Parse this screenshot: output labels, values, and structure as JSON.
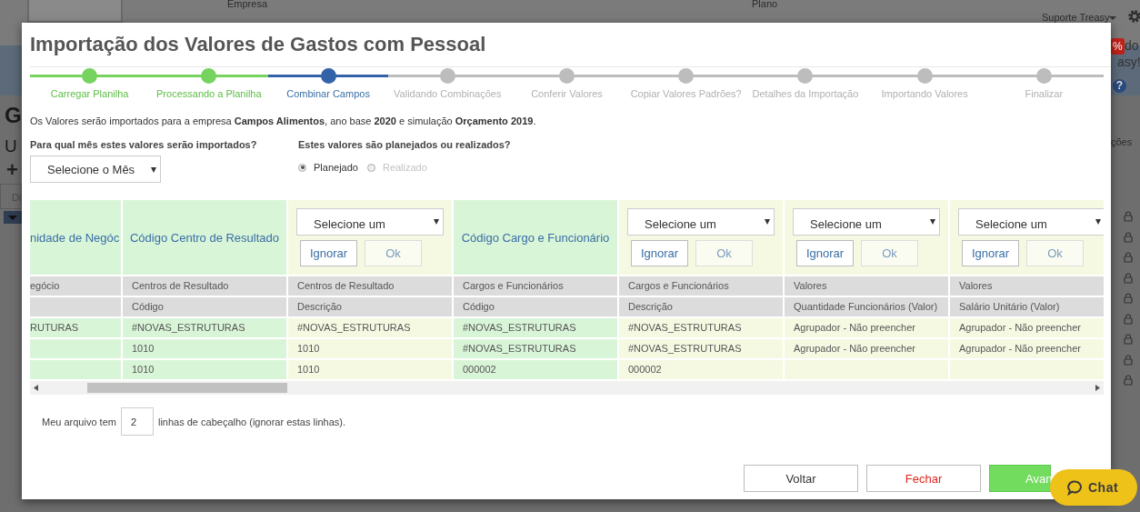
{
  "background": {
    "company_label": "Empresa",
    "plan_label": "Plano",
    "user": "Suporte Treasy",
    "page_title": "G",
    "page_subtitle": "U",
    "add": "+",
    "field": "Di",
    "badge": "%",
    "notice_1": "do",
    "notice_2": "asy!",
    "column_text": "ções",
    "help": "?"
  },
  "modal": {
    "title": "Importação dos Valores de Gastos com Pessoal",
    "steps": [
      {
        "label": "Carregar Planilha",
        "completed": true,
        "selected": false
      },
      {
        "label": "Processando a Planilha",
        "completed": true,
        "selected": false
      },
      {
        "label": "Combinar Campos",
        "completed": false,
        "selected": true
      },
      {
        "label": "Validando Combinações",
        "completed": false,
        "selected": false
      },
      {
        "label": "Conferir Valores",
        "completed": false,
        "selected": false
      },
      {
        "label": "Copiar Valores Padrões?",
        "completed": false,
        "selected": false
      },
      {
        "label": "Detalhes da Importação",
        "completed": false,
        "selected": false
      },
      {
        "label": "Importando Valores",
        "completed": false,
        "selected": false
      },
      {
        "label": "Finalizar",
        "completed": false,
        "selected": false
      }
    ],
    "intro": "Os Valores serão importados para a empresa **Campos Alimentos**, ano base **2020** e simulação **Orçamento 2019**.",
    "month_question": "Para qual mês estes valores serão importados?",
    "month_select": "Selecione o Mês",
    "type_question": "Estes valores são planejados ou realizados?",
    "radios": [
      {
        "label": "Planejado",
        "selected": true,
        "disabled": false
      },
      {
        "label": "Realizado",
        "selected": false,
        "disabled": true
      }
    ],
    "columns": [
      {
        "kind": "mapped",
        "title": "nidade de Negóc",
        "group": "egócio",
        "cells": [
          "RUTURAS",
          null,
          null
        ]
      },
      {
        "kind": "mapped",
        "title": "Código Centro de Resultado",
        "group": "Centros de Resultado",
        "field": "Código",
        "cells": [
          "#NOVAS_ESTRUTURAS",
          "1010",
          "1010"
        ]
      },
      {
        "kind": "unmapped",
        "select": "Selecione um",
        "ignore": "Ignorar",
        "ok": "Ok",
        "group": "Centros de Resultado",
        "field": "Descrição",
        "cells": [
          "#NOVAS_ESTRUTURAS",
          "1010",
          "1010"
        ]
      },
      {
        "kind": "mapped",
        "title": "Código Cargo e Funcionário",
        "group": "Cargos e Funcionários",
        "field": "Código",
        "cells": [
          "#NOVAS_ESTRUTURAS",
          "#NOVAS_ESTRUTURAS",
          "000002"
        ]
      },
      {
        "kind": "unmapped",
        "select": "Selecione um",
        "ignore": "Ignorar",
        "ok": "Ok",
        "group": "Cargos e Funcionários",
        "field": "Descrição",
        "cells": [
          "#NOVAS_ESTRUTURAS",
          "#NOVAS_ESTRUTURAS",
          "000002"
        ]
      },
      {
        "kind": "unmapped",
        "select": "Selecione um",
        "ignore": "Ignorar",
        "ok": "Ok",
        "group": "Valores",
        "field": "Quantidade Funcionários (Valor)",
        "cells": [
          "Agrupador - Não preencher",
          "Agrupador - Não preencher",
          null
        ]
      },
      {
        "kind": "unmapped",
        "select": "Selecione um",
        "ignore": "Ignorar",
        "ok": "Ok",
        "group": "Valores",
        "field": "Salário Unitário (Valor)",
        "cells": [
          "Agrupador - Não preencher",
          "Agrupador - Não preencher",
          null
        ]
      }
    ],
    "header_lines": {
      "prefix": "Meu arquivo tem",
      "value": "2",
      "suffix": "linhas de cabeçalho (ignorar estas linhas)."
    },
    "buttons": [
      {
        "label": "Voltar",
        "kind": "default"
      },
      {
        "label": "Fechar",
        "kind": "danger"
      },
      {
        "label": "Avan",
        "kind": "primary"
      }
    ]
  },
  "chat": {
    "label": "Chat"
  }
}
